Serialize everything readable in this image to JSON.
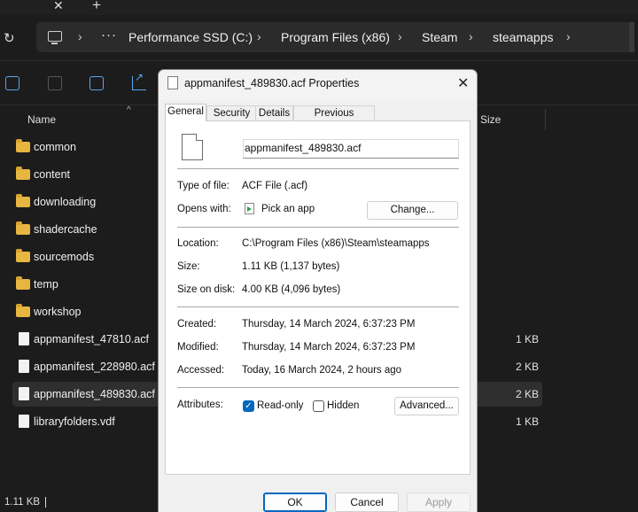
{
  "tabbar": {
    "close_glyph": "✕",
    "new_tab_glyph": "+"
  },
  "address": {
    "refresh_glyph": "↻",
    "overflow": "···",
    "chevron": "›",
    "breadcrumbs": [
      "Performance SSD (C:)",
      "Program Files (x86)",
      "Steam",
      "steamapps"
    ]
  },
  "columns": {
    "name": "Name",
    "size": "Size",
    "sort_glyph": "^"
  },
  "files": [
    {
      "name": "common",
      "type": "folder",
      "size": ""
    },
    {
      "name": "content",
      "type": "folder",
      "size": ""
    },
    {
      "name": "downloading",
      "type": "folder",
      "size": ""
    },
    {
      "name": "shadercache",
      "type": "folder",
      "size": ""
    },
    {
      "name": "sourcemods",
      "type": "folder",
      "size": ""
    },
    {
      "name": "temp",
      "type": "folder",
      "size": ""
    },
    {
      "name": "workshop",
      "type": "folder",
      "size": ""
    },
    {
      "name": "appmanifest_47810.acf",
      "type": "file",
      "size": "1 KB"
    },
    {
      "name": "appmanifest_228980.acf",
      "type": "file",
      "size": "2 KB"
    },
    {
      "name": "appmanifest_489830.acf",
      "type": "file",
      "size": "2 KB",
      "selected": true
    },
    {
      "name": "libraryfolders.vdf",
      "type": "file",
      "size": "1 KB"
    }
  ],
  "status": {
    "selection_size": "1.11 KB"
  },
  "dialog": {
    "title": "appmanifest_489830.acf Properties",
    "close_glyph": "✕",
    "tabs": [
      "General",
      "Security",
      "Details",
      "Previous Versions"
    ],
    "active_tab": "General",
    "file_name": "appmanifest_489830.acf",
    "labels": {
      "type": "Type of file:",
      "opens_with": "Opens with:",
      "location": "Location:",
      "size": "Size:",
      "size_on_disk": "Size on disk:",
      "created": "Created:",
      "modified": "Modified:",
      "accessed": "Accessed:",
      "attributes": "Attributes:"
    },
    "values": {
      "type": "ACF File (.acf)",
      "opens_with": "Pick an app",
      "location": "C:\\Program Files (x86)\\Steam\\steamapps",
      "size": "1.11 KB (1,137 bytes)",
      "size_on_disk": "4.00 KB (4,096 bytes)",
      "created": "Thursday, 14 March 2024, 6:37:23 PM",
      "modified": "Thursday, 14 March 2024, 6:37:23 PM",
      "accessed": "Today, 16 March 2024, 2 hours ago"
    },
    "buttons": {
      "change": "Change...",
      "advanced": "Advanced...",
      "ok": "OK",
      "cancel": "Cancel",
      "apply": "Apply"
    },
    "attributes": {
      "readonly_label": "Read-only",
      "readonly_checked": true,
      "hidden_label": "Hidden",
      "hidden_checked": false,
      "check_glyph": "✓"
    }
  }
}
